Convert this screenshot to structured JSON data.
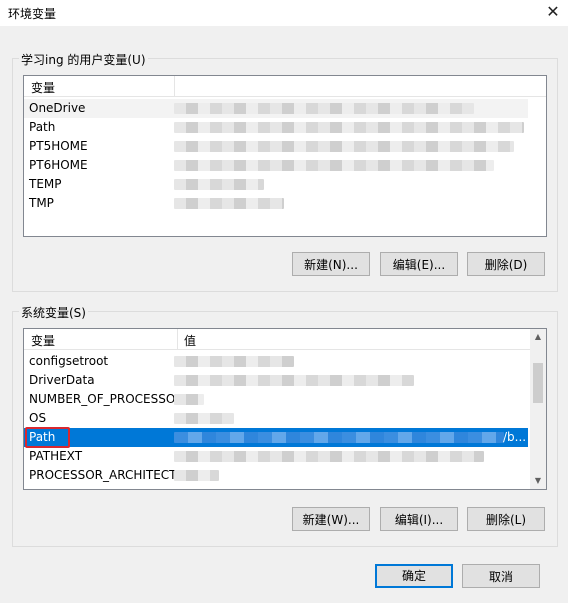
{
  "window": {
    "title": "环境变量"
  },
  "user_vars": {
    "title": "学习ing 的用户变量(U)",
    "col_name": "变量",
    "rows": [
      {
        "name": "OneDrive"
      },
      {
        "name": "Path"
      },
      {
        "name": "PT5HOME"
      },
      {
        "name": "PT6HOME"
      },
      {
        "name": "TEMP"
      },
      {
        "name": "TMP"
      }
    ],
    "buttons": {
      "new": "新建(N)...",
      "edit": "编辑(E)...",
      "delete": "删除(D)"
    }
  },
  "system_vars": {
    "title": "系统变量(S)",
    "col_name": "变量",
    "col_value": "值",
    "rows": [
      {
        "name": "configsetroot"
      },
      {
        "name": "DriverData"
      },
      {
        "name": "NUMBER_OF_PROCESSORS"
      },
      {
        "name": "OS"
      },
      {
        "name": "Path",
        "value_tail": "/b..."
      },
      {
        "name": "PATHEXT"
      },
      {
        "name": "PROCESSOR_ARCHITECT..."
      }
    ],
    "buttons": {
      "new": "新建(W)...",
      "edit": "编辑(I)...",
      "delete": "删除(L)"
    }
  },
  "footer": {
    "ok": "确定",
    "cancel": "取消"
  },
  "colors": {
    "selection": "#0078d7",
    "highlight_box": "#d9282f"
  },
  "icons": {
    "close": "close-icon",
    "scroll_up": "chevron-up-icon",
    "scroll_down": "chevron-down-icon"
  }
}
